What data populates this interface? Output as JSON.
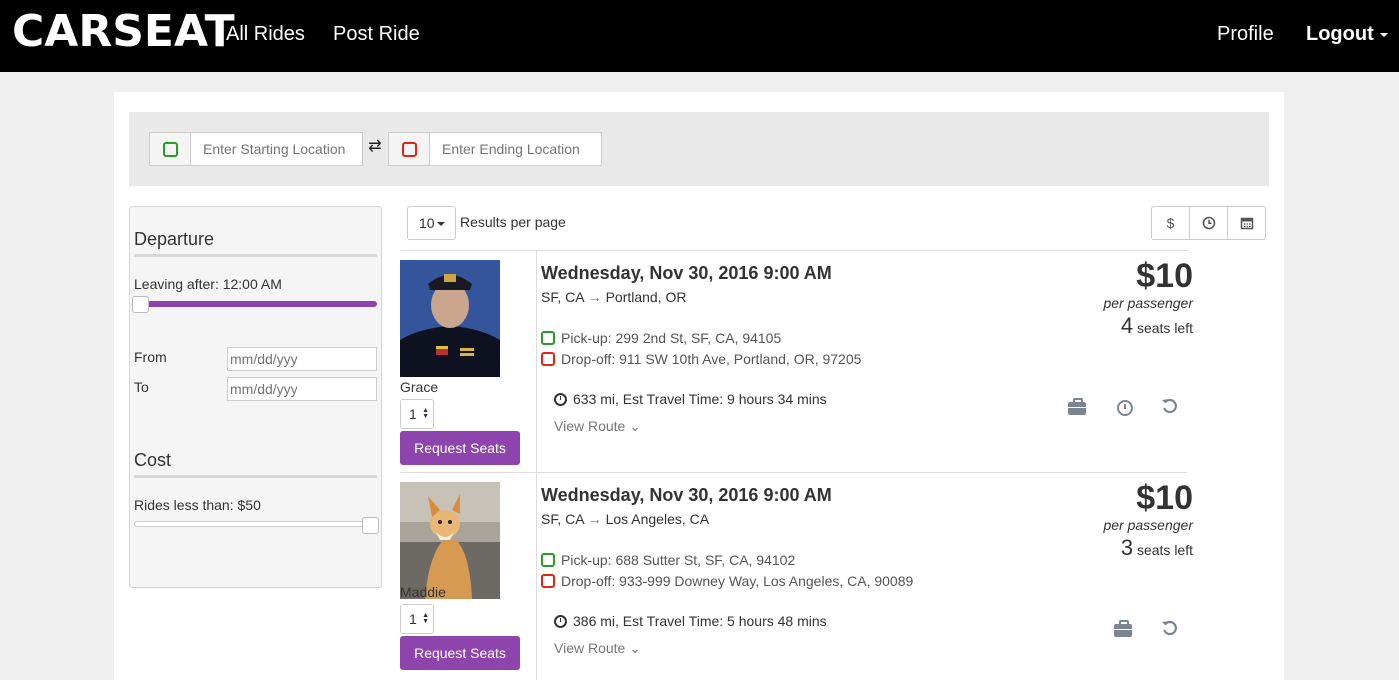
{
  "nav": {
    "logo": "CARSEAT",
    "links": [
      "All Rides",
      "Post Ride"
    ],
    "profile": "Profile",
    "logout": "Logout"
  },
  "search": {
    "start_placeholder": "Enter Starting Location",
    "end_placeholder": "Enter Ending Location"
  },
  "filters": {
    "departure_heading": "Departure",
    "leaving_after": "Leaving after: 12:00 AM",
    "from_label": "From",
    "to_label": "To",
    "date_placeholder": "mm/dd/yyy",
    "cost_heading": "Cost",
    "rides_less_than": "Rides less than: $50",
    "departure_slider_value": 0,
    "cost_slider_value": 1
  },
  "results": {
    "per_page_value": "10",
    "per_page_label": "Results per page",
    "sort_icons": [
      "dollar-icon",
      "clock-icon",
      "calendar-icon"
    ]
  },
  "rides": [
    {
      "driver": "Grace",
      "seat_count": "1",
      "request_label": "Request Seats",
      "date": "Wednesday, Nov 30, 2016 9:00 AM",
      "origin": "SF, CA",
      "destination": "Portland, OR",
      "pickup_label": "Pick-up:",
      "pickup": "299 2nd St, SF, CA, 94105",
      "dropoff_label": "Drop-off:",
      "dropoff": "911 SW 10th Ave, Portland, OR, 97205",
      "trip": "633 mi, Est Travel Time: 9 hours 34 mins",
      "view_route": "View Route",
      "price": "$10",
      "per_passenger": "per passenger",
      "seats_left_num": "4",
      "seats_left_label": "seats left",
      "icons": [
        "briefcase-icon",
        "clock-icon",
        "undo-icon"
      ]
    },
    {
      "driver": "Maddie",
      "seat_count": "1",
      "request_label": "Request Seats",
      "date": "Wednesday, Nov 30, 2016 9:00 AM",
      "origin": "SF, CA",
      "destination": "Los Angeles, CA",
      "pickup_label": "Pick-up:",
      "pickup": "688 Sutter St, SF, CA, 94102",
      "dropoff_label": "Drop-off:",
      "dropoff": "933-999 Downey Way, Los Angeles, CA, 90089",
      "trip": "386 mi, Est Travel Time: 5 hours 48 mins",
      "view_route": "View Route",
      "price": "$10",
      "per_passenger": "per passenger",
      "seats_left_num": "3",
      "seats_left_label": "seats left",
      "icons": [
        "briefcase-icon",
        "undo-icon"
      ]
    }
  ],
  "colors": {
    "accent": "#8e44ad",
    "pickup": "#2a9a2a",
    "dropoff": "#e0261b",
    "nav": "#000000"
  }
}
